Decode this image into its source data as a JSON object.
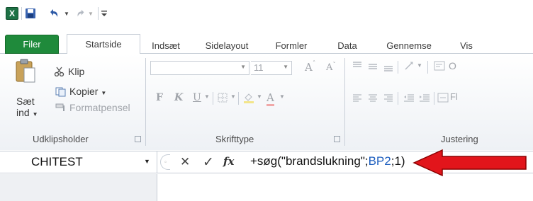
{
  "qat": {
    "app_icon": "excel-logo-icon",
    "app_letter": "X",
    "save_icon": "save-icon",
    "undo_icon": "undo-icon",
    "redo_icon": "redo-icon",
    "customize_icon": "customize-qat-icon"
  },
  "tabs": [
    {
      "label": "Filer"
    },
    {
      "label": "Startside"
    },
    {
      "label": "Indsæt"
    },
    {
      "label": "Sidelayout"
    },
    {
      "label": "Formler"
    },
    {
      "label": "Data"
    },
    {
      "label": "Gennemse"
    },
    {
      "label": "Vis"
    }
  ],
  "clipboard": {
    "paste_label_1": "Sæt",
    "paste_label_2": "ind",
    "cut_label": "Klip",
    "copy_label": "Kopier",
    "format_painter_label": "Formatpensel",
    "group_label": "Udklipsholder"
  },
  "font": {
    "font_name": "",
    "font_size": "11",
    "grow": "A",
    "shrink": "A",
    "bold": "F",
    "italic": "K",
    "underline": "U",
    "font_color": "A",
    "group_label": "Skrifttype"
  },
  "alignment": {
    "group_label": "Justering",
    "wrap_fragment": "O",
    "merge_fragment": "Fl"
  },
  "formula_bar": {
    "name_box": "CHITEST",
    "cancel_glyph": "✕",
    "enter_glyph": "✓",
    "fx_glyph": "fx",
    "formula_prefix": "+søg(\"brandslukning\";",
    "formula_ref": "BP2",
    "formula_suffix": ";1)"
  },
  "colors": {
    "file_tab": "#1f8a3b",
    "excel_logo": "#1e7145",
    "cell_ref": "#1f5fbf",
    "arrow": "#e2151b"
  }
}
